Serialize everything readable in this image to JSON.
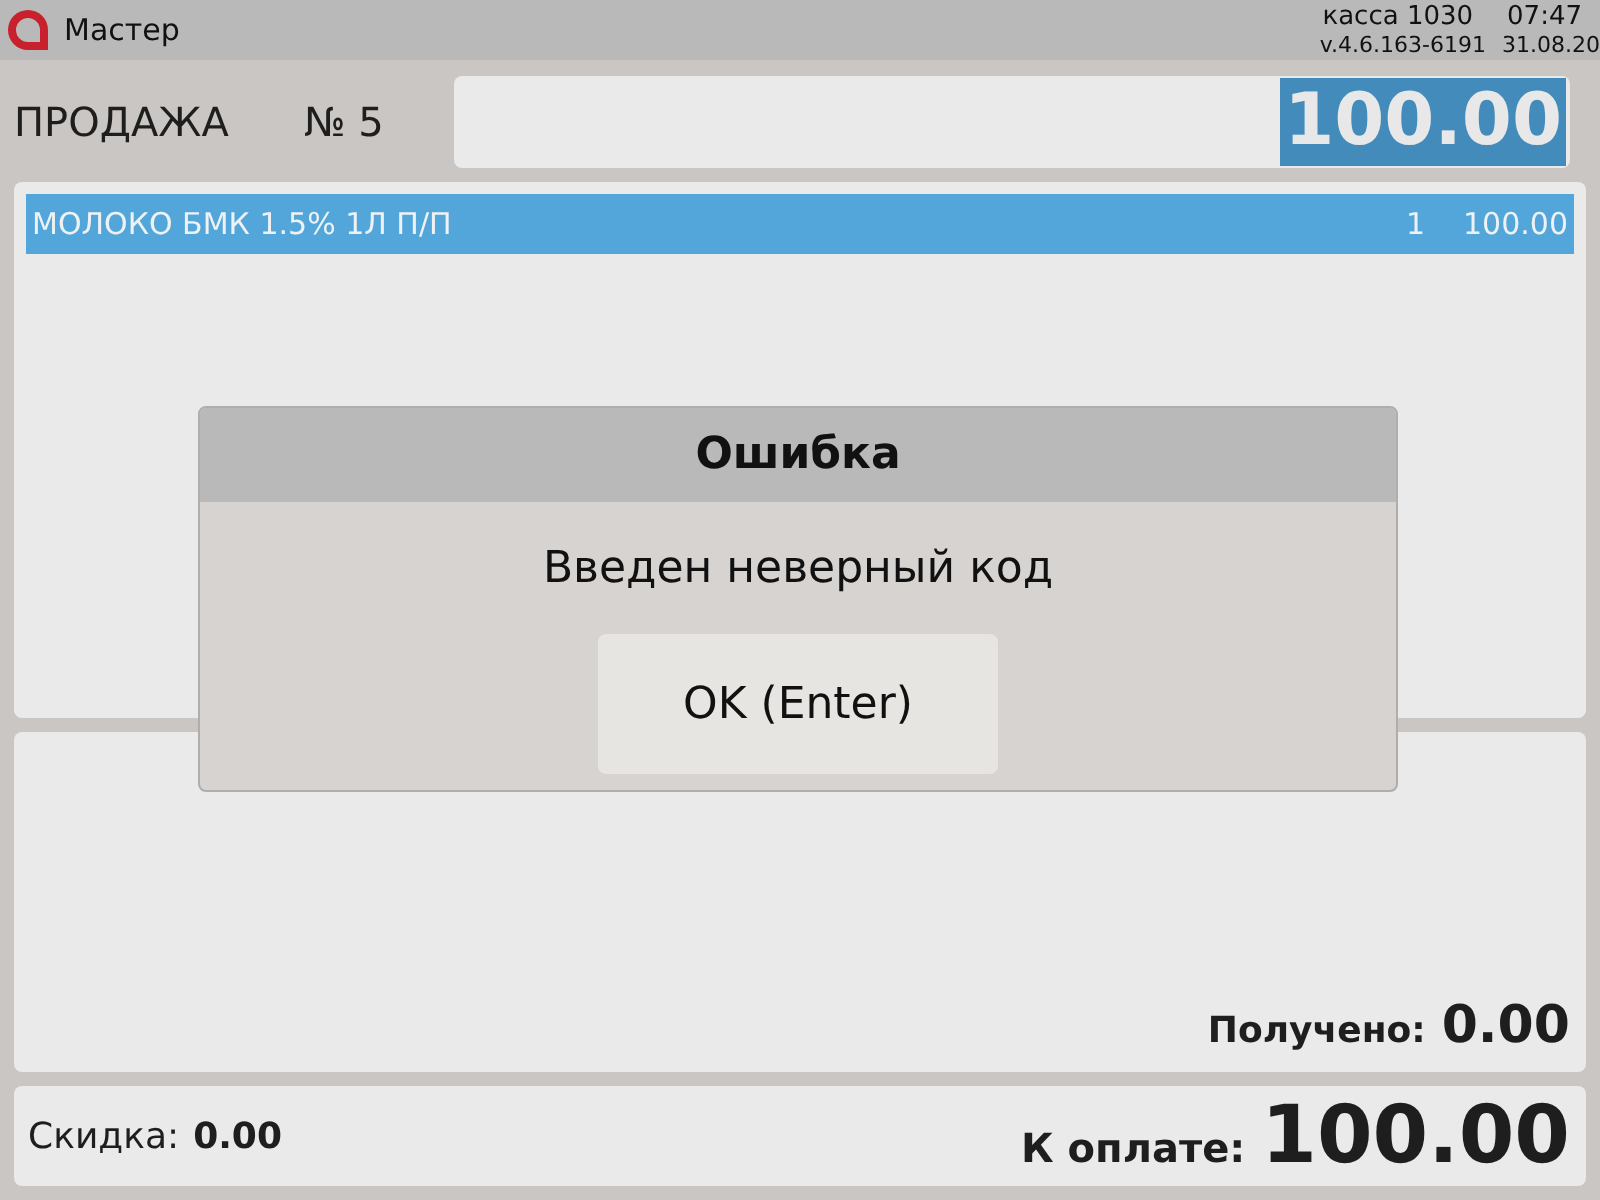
{
  "header": {
    "app_name": "Мастер",
    "register": "касса 1030",
    "time": "07:47",
    "version": "v.4.6.163-6191",
    "date": "31.08.20"
  },
  "sale": {
    "title": "ПРОДАЖА",
    "number": "№ 5",
    "input": {
      "value": "100.00",
      "selected": true
    }
  },
  "items": [
    {
      "name": "МОЛОКО БМК 1.5% 1Л П/П",
      "quantity": "1",
      "sum": "100.00",
      "selected": true
    }
  ],
  "received": {
    "label": "Получено:",
    "value": "0.00"
  },
  "footer": {
    "discount_label": "Скидка:",
    "discount": "0.00",
    "total_label": "К оплате:",
    "total": "100.00"
  },
  "dialog": {
    "title": "Ошибка",
    "message": "Введен неверный код",
    "button": "OK (Enter)"
  }
}
